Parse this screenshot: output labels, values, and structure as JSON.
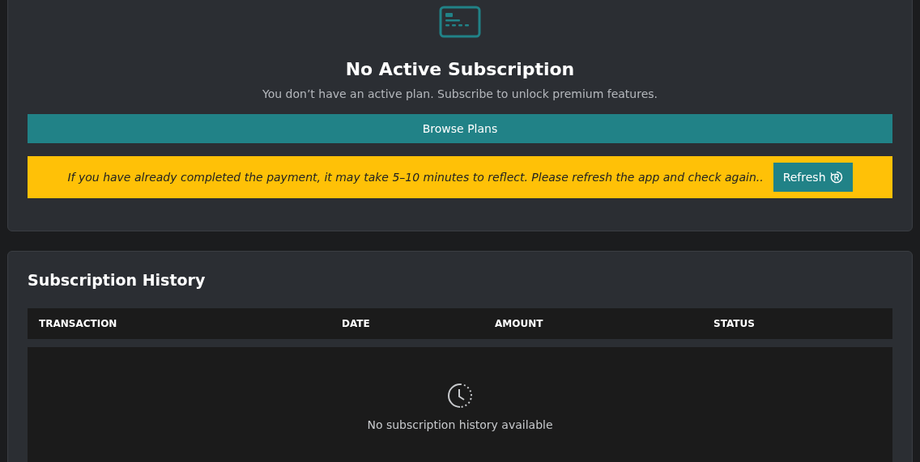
{
  "subscription": {
    "title": "No Active Subscription",
    "message": "You don’t have an active plan. Subscribe to unlock premium features.",
    "browse_button": "Browse Plans",
    "notice": {
      "text": "If you have already completed the payment, it may take 5–10 minutes to reflect. Please refresh the app and check again..",
      "refresh_button": "Refresh"
    }
  },
  "history": {
    "title": "Subscription History",
    "columns": [
      "TRANSACTION",
      "DATE",
      "AMOUNT",
      "STATUS"
    ],
    "empty_message": "No subscription history available"
  }
}
